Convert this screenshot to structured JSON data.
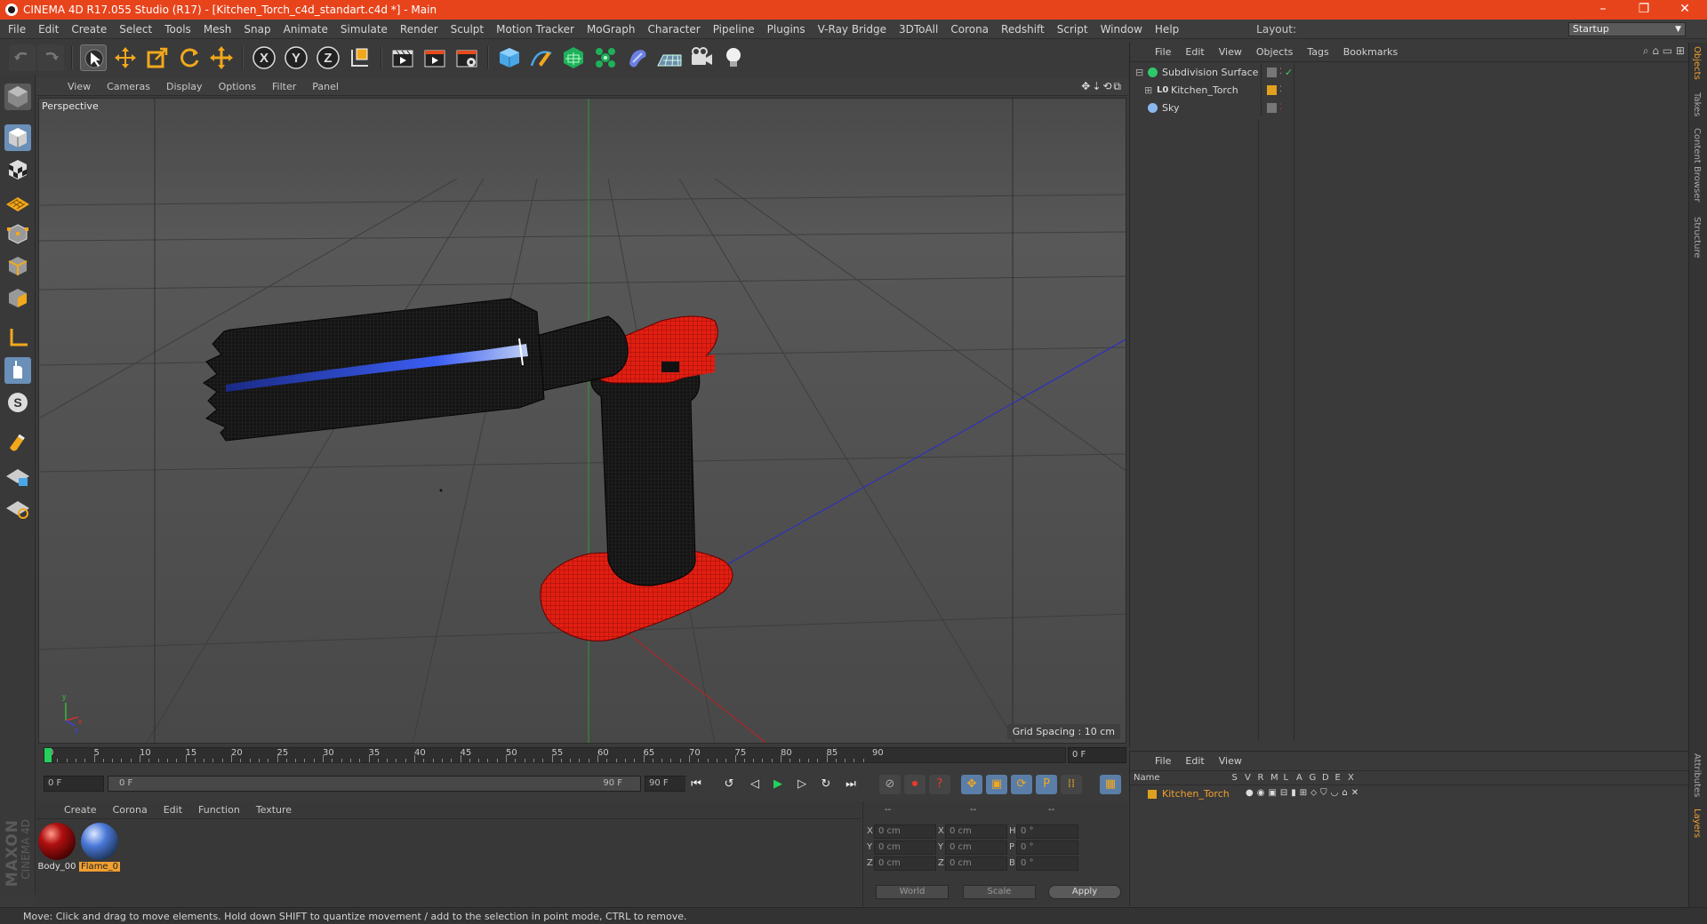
{
  "window": {
    "title": "CINEMA 4D R17.055 Studio (R17) - [Kitchen_Torch_c4d_standart.c4d *] - Main",
    "controls": [
      "–",
      "❐",
      "✕"
    ]
  },
  "menubar": {
    "items": [
      "File",
      "Edit",
      "Create",
      "Select",
      "Tools",
      "Mesh",
      "Snap",
      "Animate",
      "Simulate",
      "Render",
      "Sculpt",
      "Motion Tracker",
      "MoGraph",
      "Character",
      "Pipeline",
      "Plugins",
      "V-Ray Bridge",
      "3DToAll",
      "Corona",
      "Redshift",
      "Script",
      "Window",
      "Help"
    ],
    "layout_label": "Layout:",
    "layout_value": "Startup"
  },
  "toolbar": {
    "icons": [
      "undo-icon",
      "redo-icon",
      "live-selection-icon",
      "move-icon",
      "scale-icon",
      "rotate-icon",
      "move-add-icon",
      "x-axis-icon",
      "y-axis-icon",
      "z-axis-icon",
      "world-coord-icon",
      "render-view-icon",
      "render-picture-icon",
      "render-settings-icon",
      "cube-primitive-icon",
      "pen-spline-icon",
      "subdivision-icon",
      "cloner-icon",
      "deformer-icon",
      "floor-icon",
      "camera-icon",
      "light-icon"
    ],
    "axis_labels": [
      "X",
      "Y",
      "Z"
    ]
  },
  "left_tools": {
    "icons": [
      "make-editable-icon",
      "model-mode-icon",
      "texture-mode-icon",
      "workplane-icon",
      "points-mode-icon",
      "edges-mode-icon",
      "polygons-mode-icon",
      "axis-mode-icon",
      "tweak-mode-icon",
      "solo-icon",
      "snap-icon",
      "locked-workplane-icon",
      "planar-workplane-icon"
    ],
    "solo_label": "S"
  },
  "viewport": {
    "menu": [
      "View",
      "Cameras",
      "Display",
      "Options",
      "Filter",
      "Panel"
    ],
    "camera_label": "Perspective",
    "grid_spacing": "Grid Spacing : 10 cm"
  },
  "timeline": {
    "ticks": [
      "0",
      "5",
      "10",
      "15",
      "20",
      "25",
      "30",
      "35",
      "40",
      "45",
      "50",
      "55",
      "60",
      "65",
      "70",
      "75",
      "80",
      "85",
      "90"
    ],
    "current_frame": "0 F",
    "start_field": "0 F",
    "range_start": "0 F",
    "range_end": "90 F",
    "end_field": "90 F",
    "playback_icons": [
      "go-start-icon",
      "prev-key-icon",
      "prev-frame-icon",
      "play-icon",
      "next-frame-icon",
      "next-key-icon",
      "go-end-icon"
    ],
    "record_icons": [
      "record-position-icon",
      "autokey-icon",
      "keyframe-help-icon",
      "key-move-icon",
      "key-scale-icon",
      "key-rotate-icon",
      "key-param-icon",
      "key-pla-icon",
      "timeline-window-icon"
    ],
    "param_label": "P"
  },
  "material_manager": {
    "menu": [
      "Create",
      "Corona",
      "Edit",
      "Function",
      "Texture"
    ],
    "materials": [
      {
        "name": "Body_00",
        "color": "#b01010"
      },
      {
        "name": "Flame_0",
        "color": "#4a78d8"
      }
    ],
    "brand_lines": [
      "MAXON",
      "CINEMA 4D"
    ]
  },
  "coordinates": {
    "headers": [
      "--",
      "--",
      "--"
    ],
    "rows": [
      {
        "a": "X",
        "av": "0 cm",
        "b": "X",
        "bv": "0 cm",
        "c": "H",
        "cv": "0 °"
      },
      {
        "a": "Y",
        "av": "0 cm",
        "b": "Y",
        "bv": "0 cm",
        "c": "P",
        "cv": "0 °"
      },
      {
        "a": "Z",
        "av": "0 cm",
        "b": "Z",
        "bv": "0 cm",
        "c": "B",
        "cv": "0 °"
      }
    ],
    "mode": "World",
    "transform": "Scale",
    "apply": "Apply"
  },
  "object_manager": {
    "menu": [
      "File",
      "Edit",
      "View",
      "Objects",
      "Tags",
      "Bookmarks"
    ],
    "objects": [
      {
        "name": "Subdivision Surface",
        "icon": "subdivision-icon"
      },
      {
        "name": "Kitchen_Torch",
        "icon": "null-icon"
      },
      {
        "name": "Sky",
        "icon": "sky-icon"
      }
    ]
  },
  "layer_manager": {
    "menu": [
      "File",
      "Edit",
      "View"
    ],
    "columns": [
      "Name",
      "S",
      "V",
      "R",
      "M",
      "L",
      "A",
      "G",
      "D",
      "E",
      "X"
    ],
    "layers": [
      {
        "name": "Kitchen_Torch",
        "color": "#e0a020"
      }
    ]
  },
  "side_tabs": [
    "Objects",
    "Takes",
    "Content Browser",
    "Structure",
    "Attributes",
    "Layers"
  ],
  "status": {
    "text": "Move: Click and drag to move elements. Hold down SHIFT to quantize movement / add to the selection in point mode, CTRL to remove."
  },
  "colors": {
    "accent": "#e8441c",
    "torch_red": "#e41e12",
    "grip": "#161616",
    "flame": "#3d62ff",
    "layer_active": "#f0a030"
  }
}
